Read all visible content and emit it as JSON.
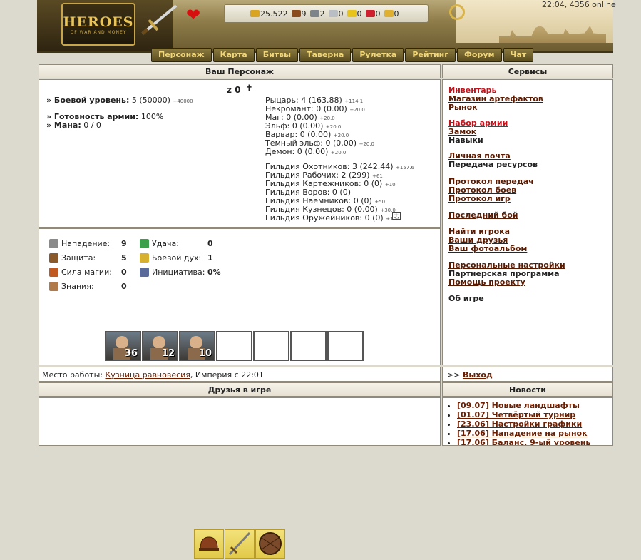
{
  "header": {
    "logo_text": "HEROES",
    "logo_sub": "OF WAR AND MONEY",
    "clock": "22:04, 4356 online",
    "resources": [
      {
        "icon": "gold-icon",
        "value": "25.522",
        "color": "#d9a520"
      },
      {
        "icon": "wood-icon",
        "value": "9",
        "color": "#8a4b1e"
      },
      {
        "icon": "ore-icon",
        "value": "2",
        "color": "#7d848a"
      },
      {
        "icon": "mercury-icon",
        "value": "0",
        "color": "#b8bec4"
      },
      {
        "icon": "sulfur-icon",
        "value": "0",
        "color": "#e8c41a"
      },
      {
        "icon": "crystal-icon",
        "value": "0",
        "color": "#d02030"
      },
      {
        "icon": "gems-icon",
        "value": "0",
        "color": "#e0b030"
      }
    ],
    "nav": [
      "Персонаж",
      "Карта",
      "Битвы",
      "Таверна",
      "Рулетка",
      "Рейтинг",
      "Форум",
      "Чат"
    ]
  },
  "character": {
    "title": "Ваш Персонаж",
    "name": "z 0",
    "combat_level_label": "» Боевой уровень:",
    "combat_level_value": "5 (50000)",
    "combat_level_small": "+40000",
    "army_ready_label": "» Готовность армии:",
    "army_ready_value": "100%",
    "mana_label": "» Мана:",
    "mana_value": "0 / 0",
    "factions": [
      {
        "name": "Рыцарь:",
        "value": "4 (163.88)",
        "small": "+114.1"
      },
      {
        "name": "Некромант:",
        "value": "0 (0.00)",
        "small": "+20.0"
      },
      {
        "name": "Маг:",
        "value": "0 (0.00)",
        "small": "+20.0"
      },
      {
        "name": "Эльф:",
        "value": "0 (0.00)",
        "small": "+20.0"
      },
      {
        "name": "Варвар:",
        "value": "0 (0.00)",
        "small": "+20.0"
      },
      {
        "name": "Темный эльф:",
        "value": "0 (0.00)",
        "small": "+20.0"
      },
      {
        "name": "Демон:",
        "value": "0 (0.00)",
        "small": "+20.0"
      }
    ],
    "guilds": [
      {
        "name": "Гильдия Охотников:",
        "value": "3 (242.44)",
        "small": "+157.6"
      },
      {
        "name": "Гильдия Рабочих:",
        "value": "2 (299)",
        "small": "+61"
      },
      {
        "name": "Гильдия Картежников:",
        "value": "0 (0)",
        "small": "+10"
      },
      {
        "name": "Гильдия Воров:",
        "value": "0 (0)",
        "small": ""
      },
      {
        "name": "Гильдия Наемников:",
        "value": "0 (0)",
        "small": "+50"
      },
      {
        "name": "Гильдия Кузнецов:",
        "value": "0 (0.00)",
        "small": "+30.0"
      },
      {
        "name": "Гильдия Оружейников:",
        "value": "0 (0)",
        "small": "+104"
      }
    ],
    "attributes": [
      {
        "icon": "attack-icon",
        "label": "Нападение:",
        "value": "9"
      },
      {
        "icon": "defense-icon",
        "label": "Защита:",
        "value": "5"
      },
      {
        "icon": "spellpower-icon",
        "label": "Сила магии:",
        "value": "0"
      },
      {
        "icon": "knowledge-icon",
        "label": "Знания:",
        "value": "0"
      }
    ],
    "attributes_right": [
      {
        "icon": "luck-icon",
        "label": "Удача:",
        "value": "0"
      },
      {
        "icon": "morale-icon",
        "label": "Боевой дух:",
        "value": "1"
      },
      {
        "icon": "initiative-icon",
        "label": "Инициатива:",
        "value": "0%"
      }
    ],
    "army": [
      "36",
      "12",
      "10",
      "",
      "",
      "",
      ""
    ],
    "work_label": "Место работы:",
    "work_place": "Кузница равновесия",
    "work_suffix": ", Империя с 22:01"
  },
  "services": {
    "title": "Сервисы",
    "items": [
      {
        "label": "Инвентарь",
        "red": true,
        "u": false
      },
      {
        "label": "Магазин артефактов",
        "red": false,
        "u": true
      },
      {
        "label": "Рынок",
        "red": false,
        "u": true
      },
      {
        "label": "Набор армии",
        "red": true,
        "u": true
      },
      {
        "label": "Замок",
        "red": false,
        "u": true
      },
      {
        "label": "Навыки",
        "red": false,
        "u": false
      },
      {
        "label": "Личная почта",
        "red": false,
        "u": true
      },
      {
        "label": "Передача ресурсов",
        "red": false,
        "u": false
      },
      {
        "label": "Протокол передач",
        "red": false,
        "u": true
      },
      {
        "label": "Протокол боев",
        "red": false,
        "u": true
      },
      {
        "label": "Протокол игр",
        "red": false,
        "u": true
      },
      {
        "label": "Последний бой",
        "red": false,
        "u": true
      },
      {
        "label": "Найти игрока",
        "red": false,
        "u": true
      },
      {
        "label": "Ваши друзья",
        "red": false,
        "u": true
      },
      {
        "label": "Ваш фотоальбом",
        "red": false,
        "u": true
      },
      {
        "label": "Персональные настройки",
        "red": false,
        "u": true
      },
      {
        "label": "Партнерская программа",
        "red": false,
        "u": false
      },
      {
        "label": "Помощь проекту",
        "red": false,
        "u": true
      },
      {
        "label": "Об игре",
        "red": false,
        "u": false
      }
    ],
    "exit_prefix": ">>",
    "exit_label": "Выход"
  },
  "friends": {
    "title": "Друзья в игре"
  },
  "news": {
    "title": "Новости",
    "items": [
      "[09.07] Новые ландшафты",
      "[01.07] Четвёртый турнир",
      "[23.06] Настройки графики",
      "[17.06] Нападение на рынок",
      "[17.06] Баланс. 9-ый уровень"
    ]
  }
}
